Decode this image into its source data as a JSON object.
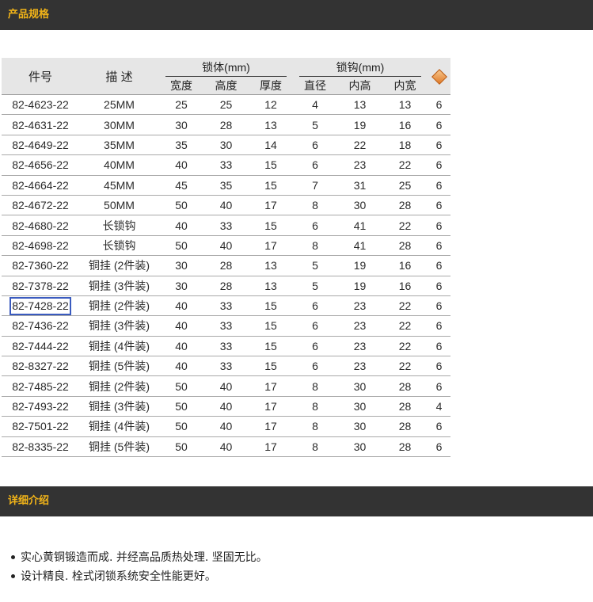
{
  "sections": {
    "spec_title": "产品规格",
    "detail_title": "详细介绍"
  },
  "table": {
    "header": {
      "part_no": "件号",
      "desc": "描 述",
      "body_group": "锁体(mm)",
      "shackle_group": "锁钩(mm)",
      "width": "宽度",
      "height": "高度",
      "thickness": "厚度",
      "diameter": "直径",
      "inner_height": "内高",
      "inner_width": "内宽"
    },
    "rows": [
      [
        "82-4623-22",
        "25MM",
        "25",
        "25",
        "12",
        "4",
        "13",
        "13",
        "6"
      ],
      [
        "82-4631-22",
        "30MM",
        "30",
        "28",
        "13",
        "5",
        "19",
        "16",
        "6"
      ],
      [
        "82-4649-22",
        "35MM",
        "35",
        "30",
        "14",
        "6",
        "22",
        "18",
        "6"
      ],
      [
        "82-4656-22",
        "40MM",
        "40",
        "33",
        "15",
        "6",
        "23",
        "22",
        "6"
      ],
      [
        "82-4664-22",
        "45MM",
        "45",
        "35",
        "15",
        "7",
        "31",
        "25",
        "6"
      ],
      [
        "82-4672-22",
        "50MM",
        "50",
        "40",
        "17",
        "8",
        "30",
        "28",
        "6"
      ],
      [
        "82-4680-22",
        "长锁钩",
        "40",
        "33",
        "15",
        "6",
        "41",
        "22",
        "6"
      ],
      [
        "82-4698-22",
        "长锁钩",
        "50",
        "40",
        "17",
        "8",
        "41",
        "28",
        "6"
      ],
      [
        "82-7360-22",
        "铜挂 (2件装)",
        "30",
        "28",
        "13",
        "5",
        "19",
        "16",
        "6"
      ],
      [
        "82-7378-22",
        "铜挂 (3件装)",
        "30",
        "28",
        "13",
        "5",
        "19",
        "16",
        "6"
      ],
      [
        "82-7428-22",
        "铜挂 (2件装)",
        "40",
        "33",
        "15",
        "6",
        "23",
        "22",
        "6"
      ],
      [
        "82-7436-22",
        "铜挂 (3件装)",
        "40",
        "33",
        "15",
        "6",
        "23",
        "22",
        "6"
      ],
      [
        "82-7444-22",
        "铜挂 (4件装)",
        "40",
        "33",
        "15",
        "6",
        "23",
        "22",
        "6"
      ],
      [
        "82-8327-22",
        "铜挂 (5件装)",
        "40",
        "33",
        "15",
        "6",
        "23",
        "22",
        "6"
      ],
      [
        "82-7485-22",
        "铜挂 (2件装)",
        "50",
        "40",
        "17",
        "8",
        "30",
        "28",
        "6"
      ],
      [
        "82-7493-22",
        "铜挂 (3件装)",
        "50",
        "40",
        "17",
        "8",
        "30",
        "28",
        "4"
      ],
      [
        "82-7501-22",
        "铜挂 (4件装)",
        "50",
        "40",
        "17",
        "8",
        "30",
        "28",
        "6"
      ],
      [
        "82-8335-22",
        "铜挂 (5件装)",
        "50",
        "40",
        "17",
        "8",
        "30",
        "28",
        "6"
      ]
    ],
    "selected_row": 10,
    "qty_icon": "box-icon"
  },
  "details": [
    "实心黄铜锻造而成. 并经高品质热处理. 坚固无比。",
    "设计精良. 栓式闭锁系统安全性能更好。"
  ]
}
